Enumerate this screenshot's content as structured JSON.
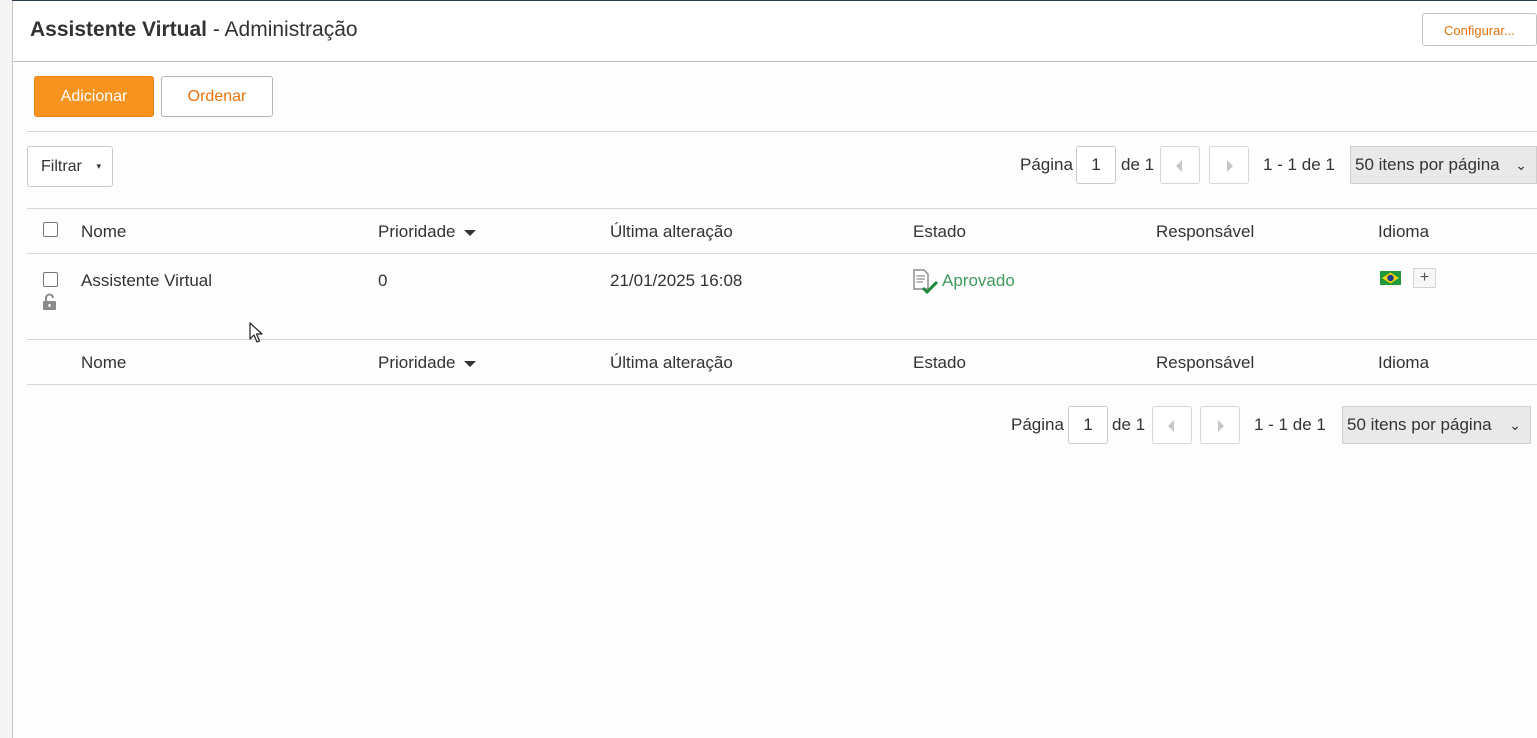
{
  "header": {
    "title_strong": "Assistente Virtual",
    "title_rest": " - Administração",
    "configure_label": "Configurar..."
  },
  "toolbar": {
    "add_label": "Adicionar",
    "order_label": "Ordenar"
  },
  "filter": {
    "label": "Filtrar",
    "caret": "▾"
  },
  "pagination": {
    "page_label": "Página",
    "current_page": "1",
    "of_label": "de 1",
    "range_label": "1 - 1 de 1",
    "per_page_selected": "50 itens por página",
    "chevron": "⌄"
  },
  "table": {
    "columns": {
      "name": "Nome",
      "priority": "Prioridade",
      "last_change": "Última alteração",
      "status": "Estado",
      "responsible": "Responsável",
      "language": "Idioma"
    },
    "rows": [
      {
        "name": "Assistente Virtual",
        "priority": "0",
        "last_change": "21/01/2025 16:08",
        "status": "Aprovado",
        "responsible": "",
        "locked": true
      }
    ],
    "add_language": "+"
  },
  "colors": {
    "accent_orange": "#f7931e",
    "link_orange": "#e8710a",
    "approved_green": "#3f9a5c"
  }
}
